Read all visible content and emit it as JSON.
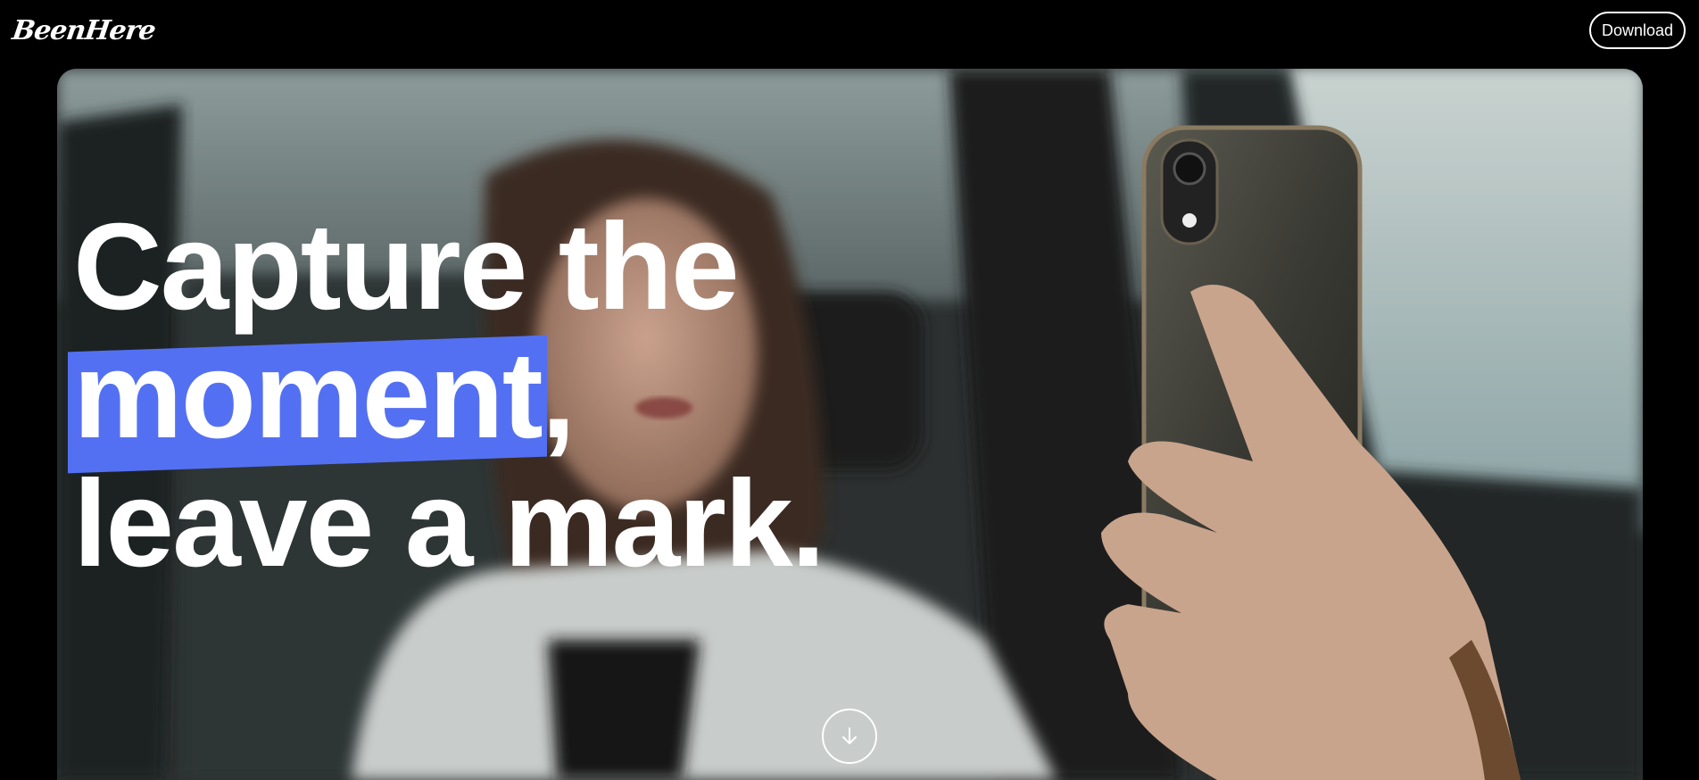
{
  "header": {
    "logo_text": "BeenHere",
    "download_label": "Download"
  },
  "hero": {
    "headline_line1": "Capture the",
    "headline_highlight": "moment",
    "headline_line2_suffix": ",",
    "headline_line3": "leave a mark.",
    "scroll_icon": "arrow-down-icon"
  },
  "colors": {
    "background": "#000000",
    "highlight": "#5470f2",
    "text": "#ffffff"
  }
}
